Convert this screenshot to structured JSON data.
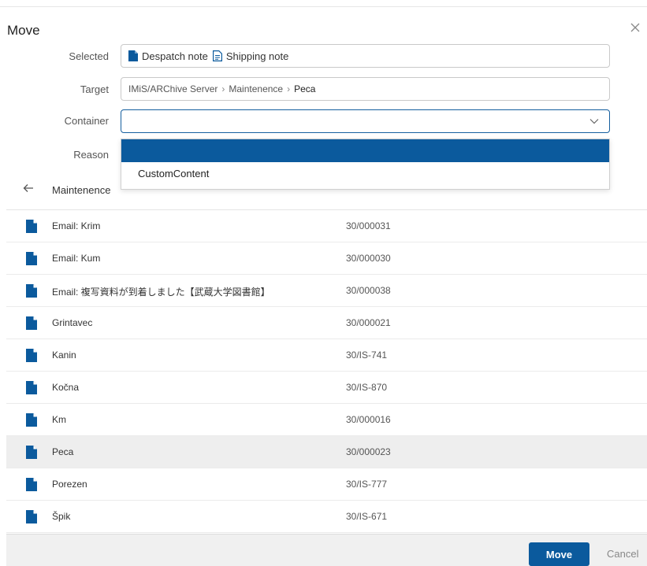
{
  "dialog": {
    "title": "Move",
    "close_icon": "close-icon"
  },
  "form": {
    "selected_label": "Selected",
    "selected_items": [
      {
        "icon": "document-filled-icon",
        "label": "Despatch note"
      },
      {
        "icon": "document-outline-icon",
        "label": "Shipping note"
      }
    ],
    "target_label": "Target",
    "target_path": [
      "IMiS/ARChive Server",
      "Maintenence",
      "Peca"
    ],
    "container_label": "Container",
    "container_value": "",
    "reason_label": "Reason"
  },
  "dropdown": {
    "options": [
      "",
      "CustomContent"
    ]
  },
  "navigation": {
    "back_icon": "arrow-left-icon",
    "current_folder": "Maintenence"
  },
  "list": {
    "items": [
      {
        "name": "Email: Krim",
        "id": "30/000031"
      },
      {
        "name": "Email: Kum",
        "id": "30/000030"
      },
      {
        "name": "Email: 複写資料が到着しました【武蔵大学図書館】",
        "id": "30/000038"
      },
      {
        "name": "Grintavec",
        "id": "30/000021"
      },
      {
        "name": "Kanin",
        "id": "30/IS-741"
      },
      {
        "name": "Kočna",
        "id": "30/IS-870"
      },
      {
        "name": "Km",
        "id": "30/000016"
      },
      {
        "name": "Peca",
        "id": "30/000023"
      },
      {
        "name": "Porezen",
        "id": "30/IS-777"
      },
      {
        "name": "Špik",
        "id": "30/IS-671"
      }
    ],
    "highlighted_index": 7
  },
  "footer": {
    "move_label": "Move",
    "cancel_label": "Cancel"
  },
  "colors": {
    "accent": "#0b5a9d"
  }
}
